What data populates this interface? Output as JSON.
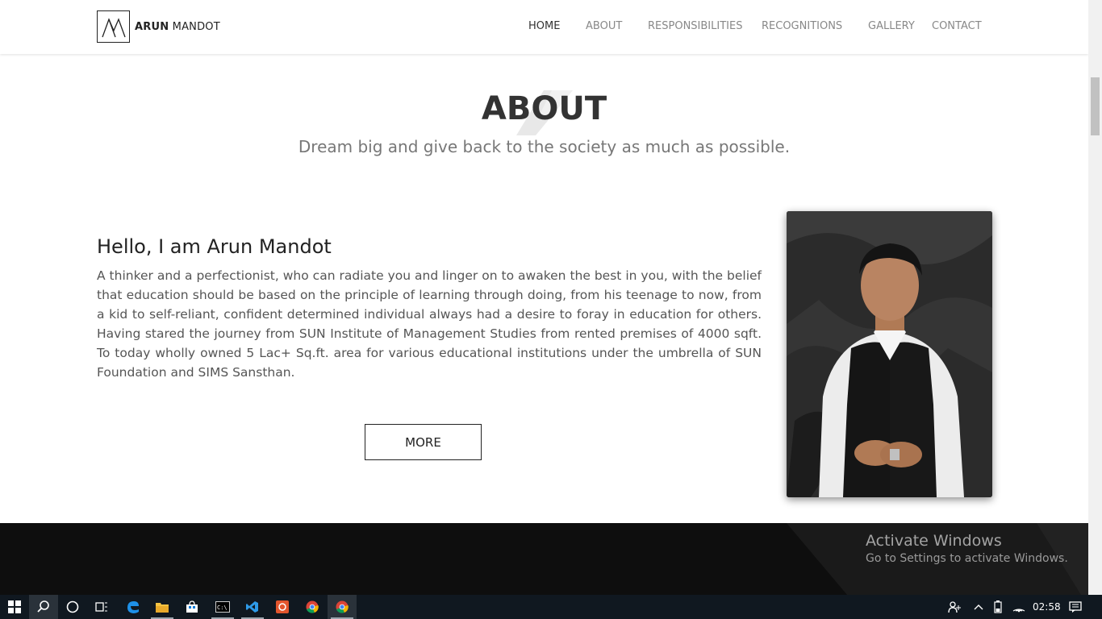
{
  "logo": {
    "brand_bold": "ARUN",
    "brand_light": "MANDOT"
  },
  "nav": {
    "items": [
      {
        "label": "HOME",
        "active": true
      },
      {
        "label": "ABOUT",
        "active": false
      },
      {
        "label": "RESPONSIBILITIES",
        "active": false
      },
      {
        "label": "RECOGNITIONS",
        "active": false
      },
      {
        "label": "GALLERY",
        "active": false
      },
      {
        "label": "CONTACT",
        "active": false
      }
    ]
  },
  "about": {
    "title": "ABOUT",
    "subtitle": "Dream big and give back to the society as much as possible."
  },
  "bio": {
    "heading": "Hello, I am Arun Mandot",
    "text": "A thinker and a perfectionist, who can radiate you and linger on to awaken the best in you, with the belief that education should be based on the principle of learning through doing, from his teenage to now, from a kid to self-reliant, confident determined individual always had a desire to foray in education for others. Having stared the journey from SUN Institute of Management Studies from rented premises of 4000 sqft. To today wholly owned 5 Lac+ Sq.ft. area for various educational institutions under the umbrella of SUN Foundation and SIMS Sansthan.",
    "more_label": "MORE"
  },
  "windows_notice": {
    "title": "Activate Windows",
    "subtitle": "Go to Settings to activate Windows."
  },
  "taskbar": {
    "clock": "02:58",
    "apps": [
      "start-icon",
      "search-icon",
      "cortana-icon",
      "task-view-icon",
      "edge-icon",
      "file-explorer-icon",
      "store-icon",
      "cmd-icon",
      "vscode-icon",
      "app-icon",
      "chrome-icon",
      "chrome-active-icon"
    ]
  },
  "colors": {
    "nav_active": "#333333",
    "nav_inactive": "#888888",
    "taskbar_bg": "#101820",
    "dark_band": "#0e0e0e"
  }
}
